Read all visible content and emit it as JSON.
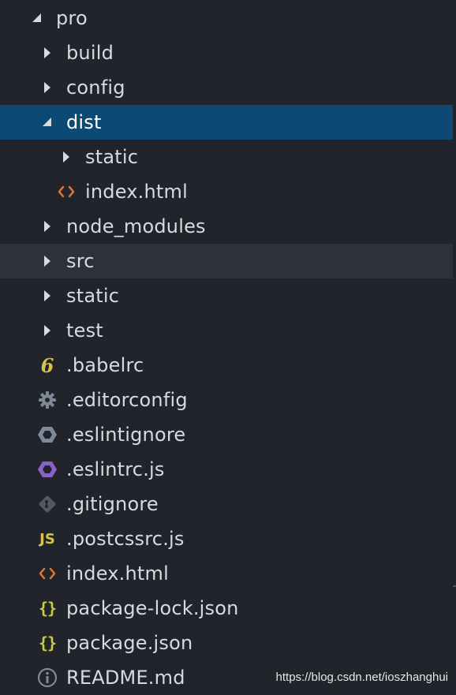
{
  "explorer": {
    "items": [
      {
        "label": "pro",
        "icon": "chevron-down-icon",
        "depth": 0
      },
      {
        "label": "build",
        "icon": "chevron-right-icon",
        "depth": 1
      },
      {
        "label": "config",
        "icon": "chevron-right-icon",
        "depth": 1
      },
      {
        "label": "dist",
        "icon": "chevron-down-icon",
        "depth": 1,
        "state": "selected"
      },
      {
        "label": "static",
        "icon": "chevron-right-icon",
        "depth": 2
      },
      {
        "label": "index.html",
        "icon": "html-icon",
        "depth": 2
      },
      {
        "label": "node_modules",
        "icon": "chevron-right-icon",
        "depth": 1
      },
      {
        "label": "src",
        "icon": "chevron-right-icon",
        "depth": 1,
        "state": "hover"
      },
      {
        "label": "static",
        "icon": "chevron-right-icon",
        "depth": 1
      },
      {
        "label": "test",
        "icon": "chevron-right-icon",
        "depth": 1
      },
      {
        "label": ".babelrc",
        "icon": "babel-icon",
        "depth": 1
      },
      {
        "label": ".editorconfig",
        "icon": "gear-icon",
        "depth": 1
      },
      {
        "label": ".eslintignore",
        "icon": "eslint-ignore-icon",
        "depth": 1
      },
      {
        "label": ".eslintrc.js",
        "icon": "eslint-icon",
        "depth": 1
      },
      {
        "label": ".gitignore",
        "icon": "git-icon",
        "depth": 1
      },
      {
        "label": ".postcssrc.js",
        "icon": "javascript-icon",
        "depth": 1
      },
      {
        "label": "index.html",
        "icon": "html-icon",
        "depth": 1
      },
      {
        "label": "package-lock.json",
        "icon": "json-icon",
        "depth": 1
      },
      {
        "label": "package.json",
        "icon": "json-icon",
        "depth": 1
      },
      {
        "label": "README.md",
        "icon": "info-icon",
        "depth": 1
      }
    ],
    "glyphs": {
      "javascript": "JS",
      "json": "{}",
      "babel": "6"
    }
  },
  "colors": {
    "background": "#21252b",
    "selected_row": "#0d4a73",
    "hover_row": "#2c313a",
    "text": "#d7dae0",
    "html_icon": "#e37933",
    "json_icon": "#cbcb41",
    "eslint_icon": "#8a62c9",
    "muted_icon": "#7f8a99"
  },
  "watermark": {
    "text": "https://blog.csdn.net/ioszhanghui"
  }
}
